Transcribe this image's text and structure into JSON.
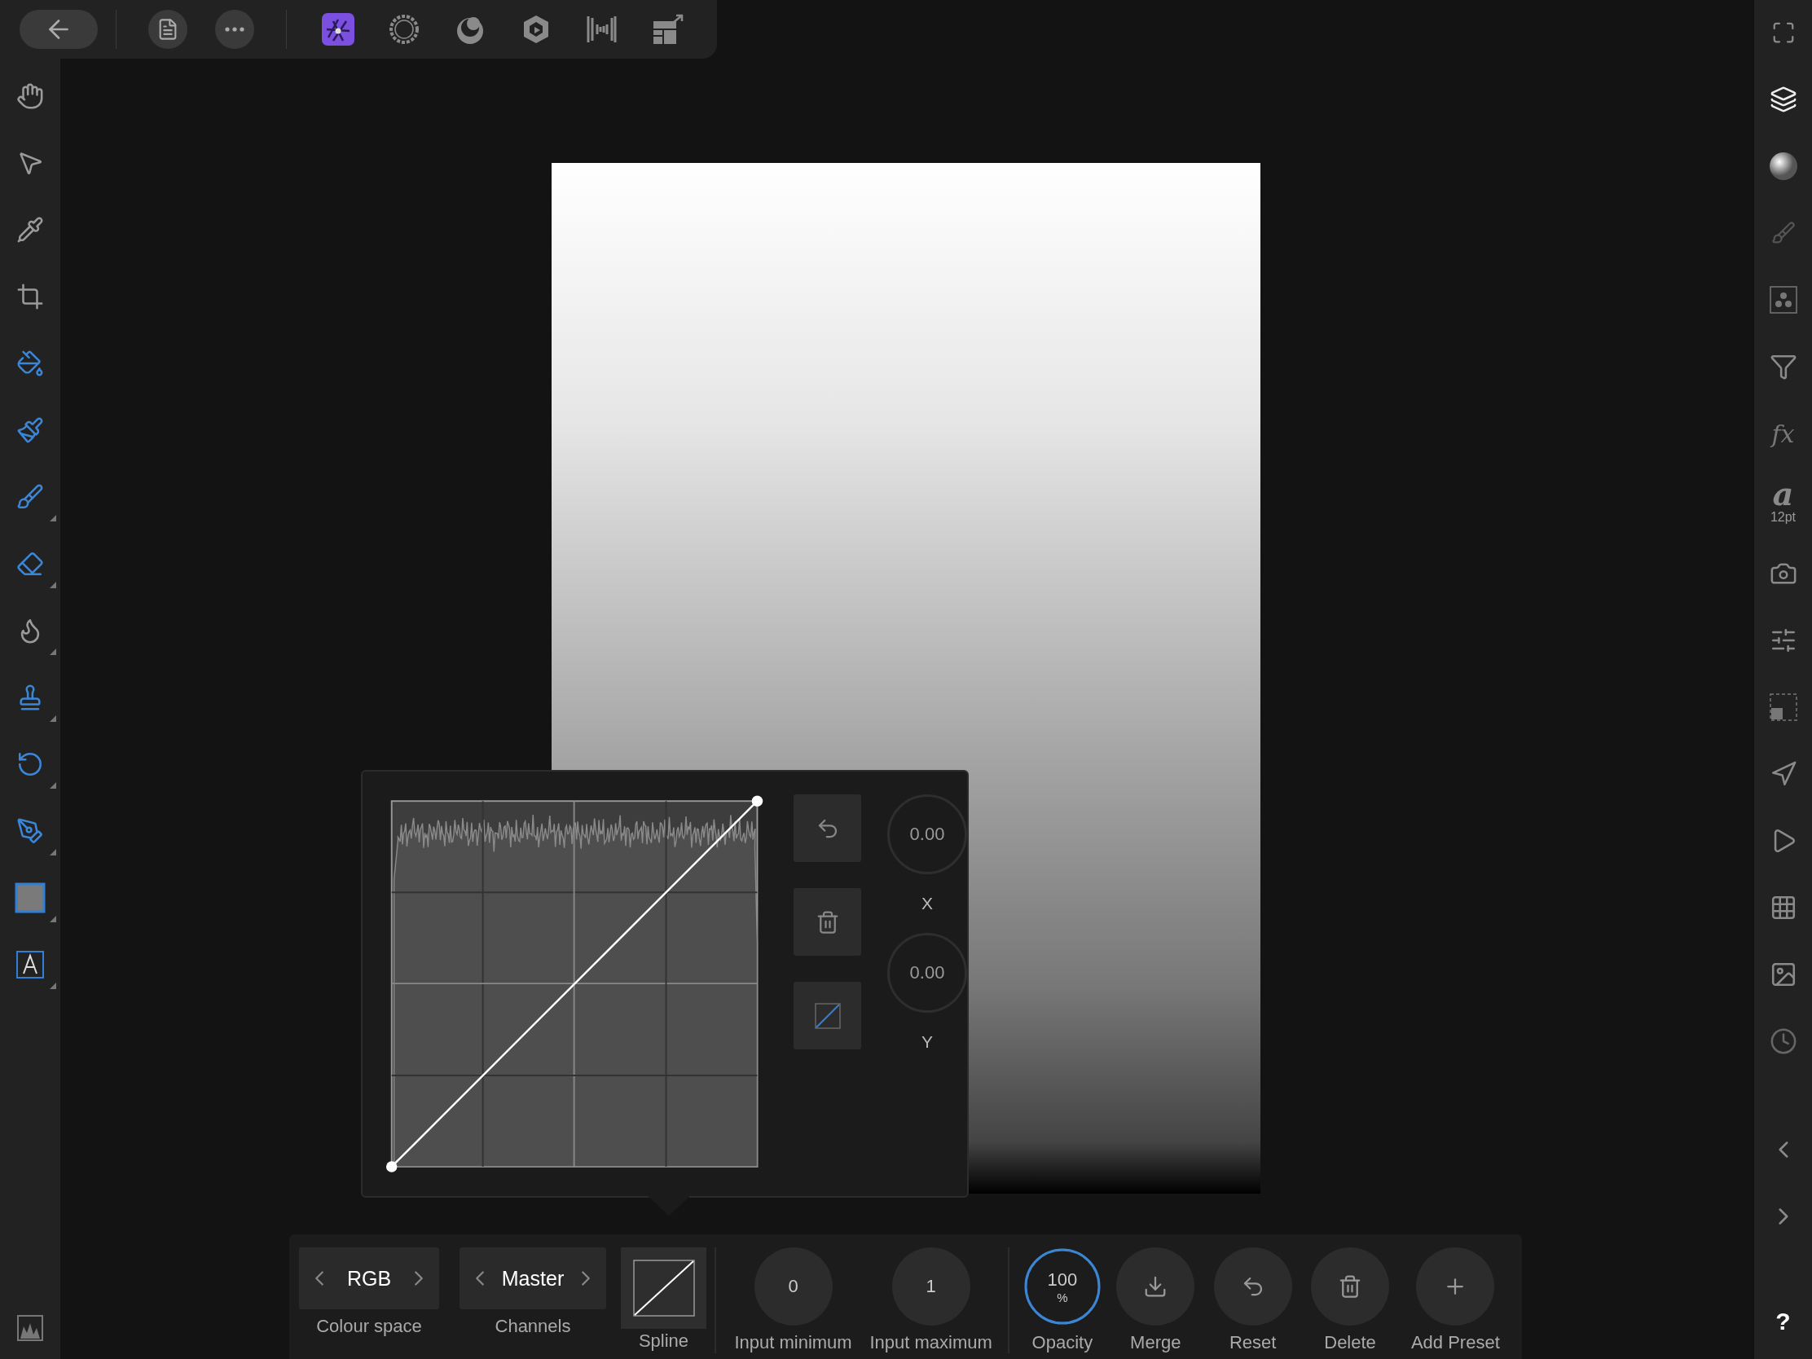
{
  "top_bar": {
    "personas": [
      {
        "selected": true
      },
      {
        "selected": false
      },
      {
        "selected": false
      },
      {
        "selected": false
      },
      {
        "selected": false
      }
    ]
  },
  "tools": [
    {
      "flyout": false
    },
    {
      "flyout": false
    },
    {
      "flyout": false
    },
    {
      "flyout": false
    },
    {
      "flyout": false
    },
    {
      "flyout": false
    },
    {
      "flyout": true
    },
    {
      "flyout": true
    },
    {
      "flyout": true
    },
    {
      "flyout": true
    },
    {
      "flyout": true
    },
    {
      "flyout": true
    },
    {
      "flyout": true
    },
    {
      "flyout": true
    }
  ],
  "right_panel": {
    "fx_label": "fx",
    "text_glyph": "a",
    "text_size": "12pt",
    "help": "?"
  },
  "curves": {
    "x_value": "0.00",
    "x_label": "X",
    "y_value": "0.00",
    "y_label": "Y"
  },
  "bottom_bar": {
    "colour_space": {
      "value": "RGB",
      "label": "Colour space"
    },
    "channels": {
      "value": "Master",
      "label": "Channels"
    },
    "spline": {
      "label": "Spline"
    },
    "input_minimum": {
      "value": "0",
      "label": "Input minimum"
    },
    "input_maximum": {
      "value": "1",
      "label": "Input maximum"
    },
    "opacity": {
      "value": "100",
      "unit": "%",
      "label": "Opacity",
      "level": 1
    },
    "actions": [
      {
        "kind": "merge",
        "label": "Merge"
      },
      {
        "kind": "reset",
        "label": "Reset"
      },
      {
        "kind": "delete",
        "label": "Delete"
      },
      {
        "kind": "add",
        "label": "Add Preset"
      }
    ]
  }
}
